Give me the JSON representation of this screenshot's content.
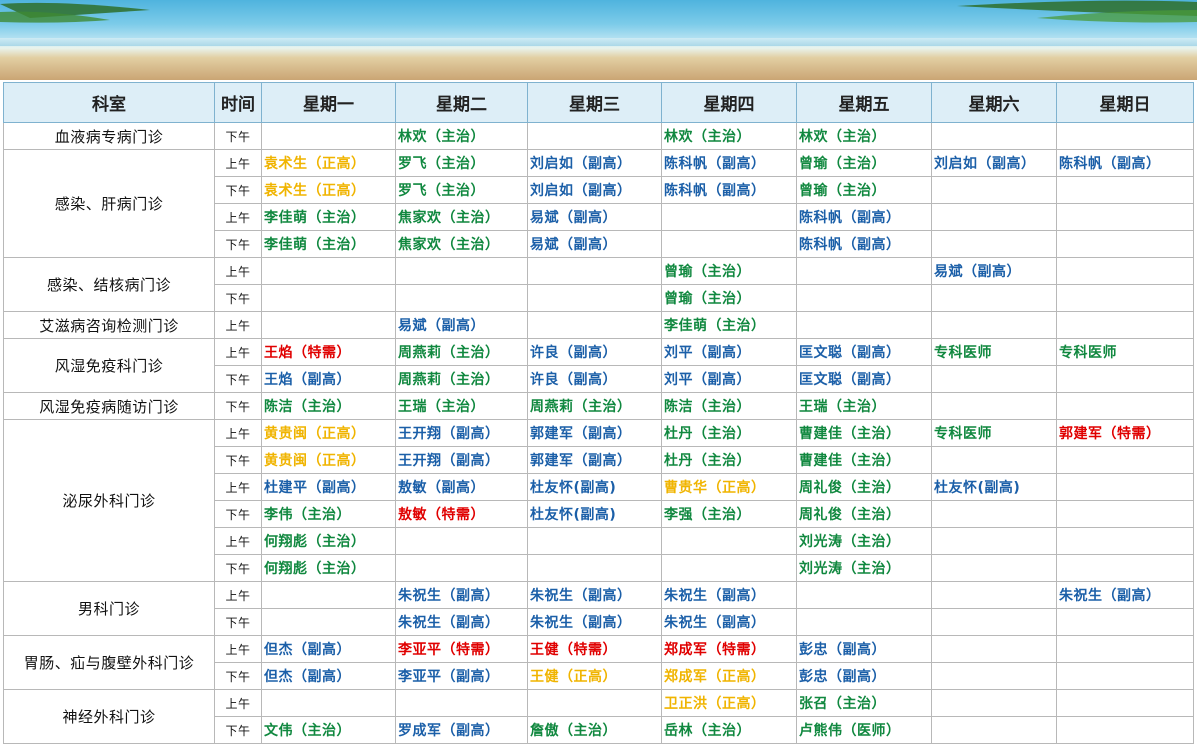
{
  "colors": {
    "green": "#10883f",
    "blue": "#1b5fa8",
    "gold": "#f0b400",
    "red": "#e00000"
  },
  "header": [
    "科室",
    "时间",
    "星期一",
    "星期二",
    "星期三",
    "星期四",
    "星期五",
    "星期六",
    "星期日"
  ],
  "departments": [
    {
      "name": "血液病专病门诊",
      "rows": [
        {
          "time": "下午",
          "cells": [
            null,
            {
              "t": "林欢（主治）",
              "c": "green"
            },
            null,
            {
              "t": "林欢（主治）",
              "c": "green"
            },
            {
              "t": "林欢（主治）",
              "c": "green"
            },
            null,
            null
          ]
        }
      ]
    },
    {
      "name": "感染、肝病门诊",
      "rows": [
        {
          "time": "上午",
          "cells": [
            {
              "t": "袁术生（正高）",
              "c": "gold"
            },
            {
              "t": "罗飞（主治）",
              "c": "green"
            },
            {
              "t": "刘启如（副高）",
              "c": "blue"
            },
            {
              "t": "陈科帆（副高）",
              "c": "blue"
            },
            {
              "t": "曾瑜（主治）",
              "c": "green"
            },
            {
              "t": "刘启如（副高）",
              "c": "blue"
            },
            {
              "t": "陈科帆（副高）",
              "c": "blue"
            }
          ]
        },
        {
          "time": "下午",
          "cells": [
            {
              "t": "袁术生（正高）",
              "c": "gold"
            },
            {
              "t": "罗飞（主治）",
              "c": "green"
            },
            {
              "t": "刘启如（副高）",
              "c": "blue"
            },
            {
              "t": "陈科帆（副高）",
              "c": "blue"
            },
            {
              "t": "曾瑜（主治）",
              "c": "green"
            },
            null,
            null
          ]
        },
        {
          "time": "上午",
          "cells": [
            {
              "t": "李佳萌（主治）",
              "c": "green"
            },
            {
              "t": "焦家欢（主治）",
              "c": "green"
            },
            {
              "t": "易斌（副高）",
              "c": "blue"
            },
            null,
            {
              "t": "陈科帆（副高）",
              "c": "blue"
            },
            null,
            null
          ]
        },
        {
          "time": "下午",
          "cells": [
            {
              "t": "李佳萌（主治）",
              "c": "green"
            },
            {
              "t": "焦家欢（主治）",
              "c": "green"
            },
            {
              "t": "易斌（副高）",
              "c": "blue"
            },
            null,
            {
              "t": "陈科帆（副高）",
              "c": "blue"
            },
            null,
            null
          ]
        }
      ]
    },
    {
      "name": "感染、结核病门诊",
      "rows": [
        {
          "time": "上午",
          "cells": [
            null,
            null,
            null,
            {
              "t": "曾瑜（主治）",
              "c": "green"
            },
            null,
            {
              "t": "易斌（副高）",
              "c": "blue"
            },
            null
          ]
        },
        {
          "time": "下午",
          "cells": [
            null,
            null,
            null,
            {
              "t": "曾瑜（主治）",
              "c": "green"
            },
            null,
            null,
            null
          ]
        }
      ]
    },
    {
      "name": "艾滋病咨询检测门诊",
      "rows": [
        {
          "time": "上午",
          "cells": [
            null,
            {
              "t": "易斌（副高）",
              "c": "blue"
            },
            null,
            {
              "t": "李佳萌（主治）",
              "c": "green"
            },
            null,
            null,
            null
          ]
        }
      ]
    },
    {
      "name": "风湿免疫科门诊",
      "rows": [
        {
          "time": "上午",
          "cells": [
            {
              "t": "王焰（特需）",
              "c": "red"
            },
            {
              "t": "周燕莉（主治）",
              "c": "green"
            },
            {
              "t": "许良（副高）",
              "c": "blue"
            },
            {
              "t": "刘平（副高）",
              "c": "blue"
            },
            {
              "t": "匡文聪（副高）",
              "c": "blue"
            },
            {
              "t": "专科医师",
              "c": "green"
            },
            {
              "t": "专科医师",
              "c": "green"
            }
          ]
        },
        {
          "time": "下午",
          "cells": [
            {
              "t": "王焰（副高）",
              "c": "blue"
            },
            {
              "t": "周燕莉（主治）",
              "c": "green"
            },
            {
              "t": "许良（副高）",
              "c": "blue"
            },
            {
              "t": "刘平（副高）",
              "c": "blue"
            },
            {
              "t": "匡文聪（副高）",
              "c": "blue"
            },
            null,
            null
          ]
        }
      ]
    },
    {
      "name": "风湿免疫病随访门诊",
      "rows": [
        {
          "time": "下午",
          "cells": [
            {
              "t": "陈洁（主治）",
              "c": "green"
            },
            {
              "t": "王瑞（主治）",
              "c": "green"
            },
            {
              "t": "周燕莉（主治）",
              "c": "green"
            },
            {
              "t": "陈洁（主治）",
              "c": "green"
            },
            {
              "t": "王瑞（主治）",
              "c": "green"
            },
            null,
            null
          ]
        }
      ]
    },
    {
      "name": "泌尿外科门诊",
      "rows": [
        {
          "time": "上午",
          "cells": [
            {
              "t": "黄贵闽（正高）",
              "c": "gold"
            },
            {
              "t": "王开翔（副高）",
              "c": "blue"
            },
            {
              "t": "郭建军（副高）",
              "c": "blue"
            },
            {
              "t": "杜丹（主治）",
              "c": "green"
            },
            {
              "t": "曹建佳（主治）",
              "c": "green"
            },
            {
              "t": "专科医师",
              "c": "green"
            },
            {
              "t": "郭建军（特需）",
              "c": "red"
            }
          ]
        },
        {
          "time": "下午",
          "cells": [
            {
              "t": "黄贵闽（正高）",
              "c": "gold"
            },
            {
              "t": "王开翔（副高）",
              "c": "blue"
            },
            {
              "t": "郭建军（副高）",
              "c": "blue"
            },
            {
              "t": "杜丹（主治）",
              "c": "green"
            },
            {
              "t": "曹建佳（主治）",
              "c": "green"
            },
            null,
            null
          ]
        },
        {
          "time": "上午",
          "cells": [
            {
              "t": "杜建平（副高）",
              "c": "blue"
            },
            {
              "t": "敖敏（副高）",
              "c": "blue"
            },
            {
              "t": "杜友怀(副高)",
              "c": "blue"
            },
            {
              "t": "曹贵华（正高）",
              "c": "gold"
            },
            {
              "t": "周礼俊（主治）",
              "c": "green"
            },
            {
              "t": "杜友怀(副高)",
              "c": "blue"
            },
            null
          ]
        },
        {
          "time": "下午",
          "cells": [
            {
              "t": "李伟（主治）",
              "c": "green"
            },
            {
              "t": "敖敏（特需）",
              "c": "red"
            },
            {
              "t": "杜友怀(副高)",
              "c": "blue"
            },
            {
              "t": "李强（主治）",
              "c": "green"
            },
            {
              "t": "周礼俊（主治）",
              "c": "green"
            },
            null,
            null
          ]
        },
        {
          "time": "上午",
          "cells": [
            {
              "t": "何翔彪（主治）",
              "c": "green"
            },
            null,
            null,
            null,
            {
              "t": "刘光涛（主治）",
              "c": "green"
            },
            null,
            null
          ]
        },
        {
          "time": "下午",
          "cells": [
            {
              "t": "何翔彪（主治）",
              "c": "green"
            },
            null,
            null,
            null,
            {
              "t": "刘光涛（主治）",
              "c": "green"
            },
            null,
            null
          ]
        }
      ]
    },
    {
      "name": "男科门诊",
      "rows": [
        {
          "time": "上午",
          "cells": [
            null,
            {
              "t": "朱祝生（副高）",
              "c": "blue"
            },
            {
              "t": "朱祝生（副高）",
              "c": "blue"
            },
            {
              "t": "朱祝生（副高）",
              "c": "blue"
            },
            null,
            null,
            {
              "t": "朱祝生（副高）",
              "c": "blue"
            }
          ]
        },
        {
          "time": "下午",
          "cells": [
            null,
            {
              "t": "朱祝生（副高）",
              "c": "blue"
            },
            {
              "t": "朱祝生（副高）",
              "c": "blue"
            },
            {
              "t": "朱祝生（副高）",
              "c": "blue"
            },
            null,
            null,
            null
          ]
        }
      ]
    },
    {
      "name": "胃肠、疝与腹壁外科门诊",
      "rows": [
        {
          "time": "上午",
          "cells": [
            {
              "t": "但杰（副高）",
              "c": "blue"
            },
            {
              "t": "李亚平（特需）",
              "c": "red"
            },
            {
              "t": "王健（特需）",
              "c": "red"
            },
            {
              "t": "郑成军（特需）",
              "c": "red"
            },
            {
              "t": "彭忠（副高）",
              "c": "blue"
            },
            null,
            null
          ]
        },
        {
          "time": "下午",
          "cells": [
            {
              "t": "但杰（副高）",
              "c": "blue"
            },
            {
              "t": "李亚平（副高）",
              "c": "blue"
            },
            {
              "t": "王健（正高）",
              "c": "gold"
            },
            {
              "t": "郑成军（正高）",
              "c": "gold"
            },
            {
              "t": "彭忠（副高）",
              "c": "blue"
            },
            null,
            null
          ]
        }
      ]
    },
    {
      "name": "神经外科门诊",
      "rows": [
        {
          "time": "上午",
          "cells": [
            null,
            null,
            null,
            {
              "t": "卫正洪（正高）",
              "c": "gold"
            },
            {
              "t": "张召（主治）",
              "c": "green"
            },
            null,
            null
          ]
        },
        {
          "time": "下午",
          "cells": [
            {
              "t": "文伟（主治）",
              "c": "green"
            },
            {
              "t": "罗成军（副高）",
              "c": "blue"
            },
            {
              "t": "詹傲（主治）",
              "c": "green"
            },
            {
              "t": "岳林（主治）",
              "c": "green"
            },
            {
              "t": "卢熊伟（医师）",
              "c": "green"
            },
            null,
            null
          ]
        }
      ]
    }
  ]
}
